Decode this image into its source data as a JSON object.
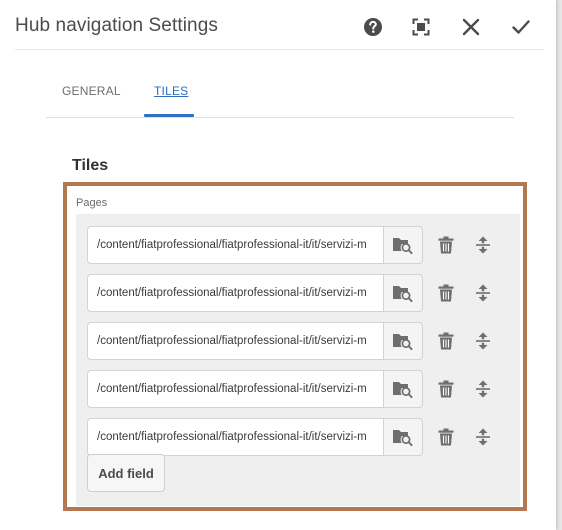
{
  "dialog": {
    "title": "Hub navigation Settings",
    "buttons": {
      "help": "help-icon",
      "fullscreen": "fullscreen-icon",
      "close": "close-icon",
      "done": "checkmark-icon"
    }
  },
  "tabs": [
    {
      "label": "GENERAL",
      "active": false
    },
    {
      "label": "TILES",
      "active": true
    }
  ],
  "section": {
    "title": "Tiles",
    "field_label": "Pages"
  },
  "pages": [
    {
      "value": "/content/fiatprofessional/fiatprofessional-it/it/servizi-m"
    },
    {
      "value": "/content/fiatprofessional/fiatprofessional-it/it/servizi-m"
    },
    {
      "value": "/content/fiatprofessional/fiatprofessional-it/it/servizi-m"
    },
    {
      "value": "/content/fiatprofessional/fiatprofessional-it/it/servizi-m"
    },
    {
      "value": "/content/fiatprofessional/fiatprofessional-it/it/servizi-m"
    }
  ],
  "add_field_label": "Add field",
  "colors": {
    "accent": "#326ec8",
    "highlight_frame": "#b5774f",
    "icon": "#6e6e6e"
  }
}
